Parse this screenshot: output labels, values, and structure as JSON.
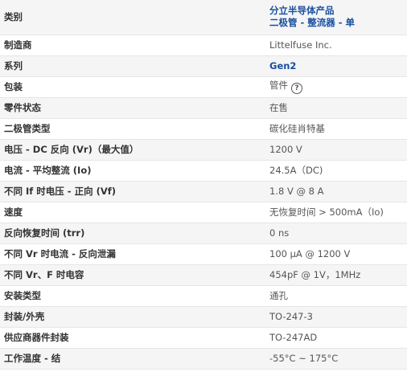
{
  "header": {
    "label": "类别",
    "category_line1": "分立半导体产品",
    "category_line2": "二极管 - 整流器 - 单"
  },
  "rows": [
    {
      "label": "制造商",
      "value": "Littelfuse Inc."
    },
    {
      "label": "系列",
      "value": "Gen2"
    },
    {
      "label": "包装",
      "value": "管件"
    },
    {
      "label": "零件状态",
      "value": "在售"
    },
    {
      "label": "二极管类型",
      "value": "碳化硅肖特基"
    },
    {
      "label": "电压 - DC 反向 (Vr)（最大值）",
      "value": "1200 V"
    },
    {
      "label": "电流 - 平均整流 (Io)",
      "value": "24.5A（DC)"
    },
    {
      "label": "不同 If 时电压 - 正向 (Vf)",
      "value": "1.8 V @ 8 A"
    },
    {
      "label": "速度",
      "value": "无恢复时间 > 500mA（Io)"
    },
    {
      "label": "反向恢复时间 (trr)",
      "value": "0 ns"
    },
    {
      "label": "不同 Vr 时电流 - 反向泄漏",
      "value": "100 µA @ 1200 V"
    },
    {
      "label": "不同 Vr、F 时电容",
      "value": "454pF @ 1V，1MHz"
    },
    {
      "label": "安装类型",
      "value": "通孔"
    },
    {
      "label": "封装/外壳",
      "value": "TO-247-3"
    },
    {
      "label": "供应商器件封装",
      "value": "TO-247AD"
    },
    {
      "label": "工作温度 - 结",
      "value": "-55°C ~ 175°C"
    }
  ],
  "icons": {
    "packaging_help": "question-circle-icon"
  },
  "help_glyph": "?",
  "colors": {
    "link": "#1a4fa0",
    "stripe": "#f5f5f5"
  }
}
